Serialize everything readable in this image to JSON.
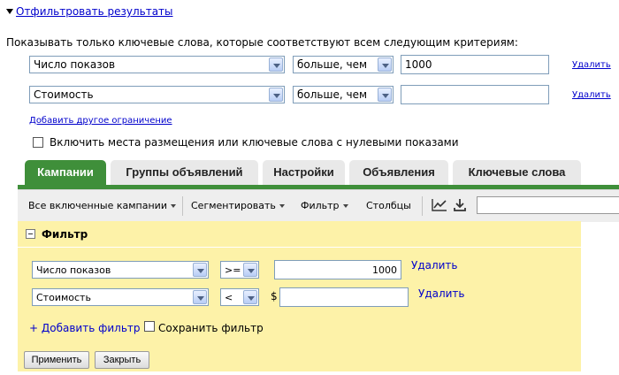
{
  "filter_toggle": {
    "label": "Отфильтровать результаты"
  },
  "criteria_text": "Показывать только  ключевые слова, которые соответствуют всем следующим критериям:",
  "rows": [
    {
      "metric": "Число показов",
      "operator": "больше, чем",
      "value": "1000",
      "remove": "Удалить"
    },
    {
      "metric": "Стоимость",
      "operator": "больше, чем",
      "value": "",
      "remove": "Удалить"
    }
  ],
  "add_constraint": "Добавить другое ограничение",
  "include_zero": {
    "label": "Включить места размещения или ключевые слова с нулевыми показами",
    "checked": false
  },
  "tabs": [
    "Кампании",
    "Группы объявлений",
    "Настройки",
    "Объявления",
    "Ключевые слова"
  ],
  "toolbar": {
    "campaigns": "Все включенные кампании",
    "segment": "Сегментировать",
    "filter": "Фильтр",
    "columns": "Столбцы"
  },
  "filter_panel": {
    "title": "Фильтр",
    "rows": [
      {
        "metric": "Число показов",
        "operator": ">=",
        "prefix": "",
        "value": "1000",
        "remove": "Удалить"
      },
      {
        "metric": "Стоимость",
        "operator": "<",
        "prefix": "$",
        "value": "",
        "remove": "Удалить"
      }
    ],
    "add_filter": "+ Добавить фильтр",
    "save_filter": "Сохранить фильтр",
    "apply": "Применить",
    "close": "Закрыть"
  },
  "colors": {
    "active_tab": "#3f8f3a",
    "panel_bg": "#fdf2a8",
    "link": "#0000cc"
  }
}
